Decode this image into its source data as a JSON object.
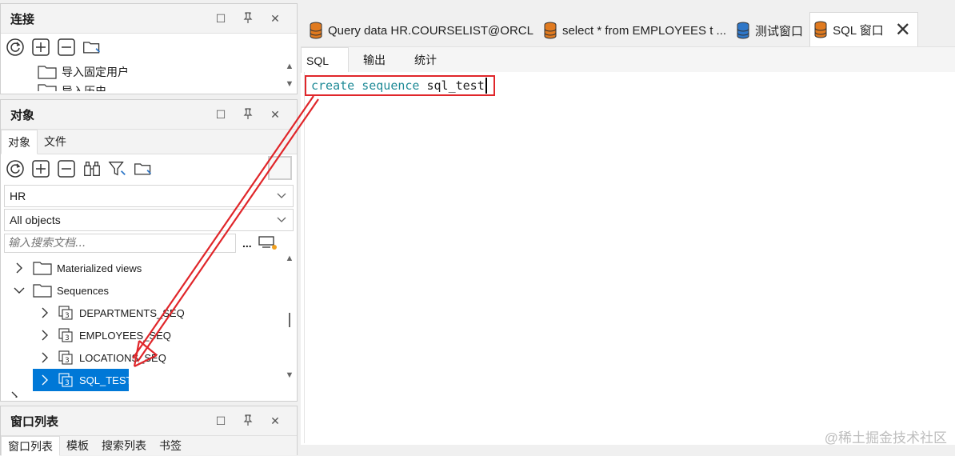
{
  "connections_panel": {
    "title": "连接",
    "items": [
      {
        "label": "导入固定用户"
      },
      {
        "label": "导入历史"
      }
    ]
  },
  "objects_panel": {
    "title": "对象",
    "tabs": [
      {
        "label": "对象"
      },
      {
        "label": "文件"
      }
    ],
    "schema_value": "HR",
    "object_type_value": "All objects",
    "search_placeholder": "输入搜索文档...",
    "search_more": "...",
    "tree": [
      {
        "label": "Materialized views",
        "type": "folder",
        "expanded": false
      },
      {
        "label": "Sequences",
        "type": "folder",
        "expanded": true
      },
      {
        "label": "DEPARTMENTS_SEQ",
        "type": "sequence"
      },
      {
        "label": "EMPLOYEES_SEQ",
        "type": "sequence"
      },
      {
        "label": "LOCATIONS_SEQ",
        "type": "sequence"
      },
      {
        "label": "SQL_TEST",
        "type": "sequence",
        "selected": true
      }
    ]
  },
  "window_list_panel": {
    "title": "窗口列表",
    "tabs": [
      {
        "label": "窗口列表"
      },
      {
        "label": "模板"
      },
      {
        "label": "搜索列表"
      },
      {
        "label": "书签"
      }
    ]
  },
  "document_tabs": [
    {
      "label": "Query data HR.COURSELIST@ORCL",
      "icon_color": "#e07a1f"
    },
    {
      "label": "select * from EMPLOYEES t ...",
      "icon_color": "#e07a1f"
    },
    {
      "label": "测试窗口",
      "icon_color": "#2f77c8"
    },
    {
      "label": "SQL 窗口",
      "icon_color": "#e07a1f",
      "active": true
    }
  ],
  "editor_tabs": [
    {
      "label": "SQL"
    },
    {
      "label": "输出"
    },
    {
      "label": "统计"
    }
  ],
  "editor": {
    "keyword1": "create",
    "keyword2": "sequence",
    "identifier": "sql_test"
  },
  "watermark": "@稀土掘金技术社区",
  "colors": {
    "accent_selection": "#0078d7",
    "annotation_red": "#e0262a",
    "keyword": "#1e8a96"
  }
}
